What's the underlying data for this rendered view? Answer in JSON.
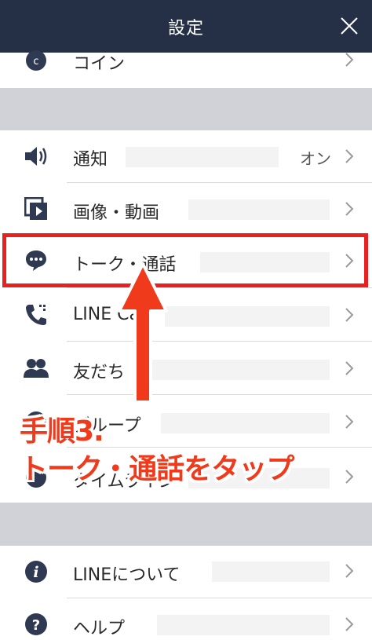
{
  "header": {
    "title": "設定"
  },
  "rows": {
    "coin": {
      "label": "コイン"
    },
    "notify": {
      "label": "通知",
      "value": "オン"
    },
    "media": {
      "label": "画像・動画"
    },
    "talk": {
      "label": "トーク・通話"
    },
    "call": {
      "label": "LINE Call"
    },
    "friends": {
      "label": "友だち"
    },
    "group": {
      "label": "グループ"
    },
    "timeline": {
      "label": "タイムライン"
    },
    "about": {
      "label": "LINEについて"
    },
    "help": {
      "label": "ヘルプ"
    }
  },
  "annotation": {
    "step": "手順3.",
    "instruction": "トーク・通話をタップ",
    "color": "#f03a1c"
  },
  "colors": {
    "header": "#253046",
    "section_gap": "#d1d1d8",
    "icon": "#2f3a52",
    "highlight": "#e8201f"
  }
}
